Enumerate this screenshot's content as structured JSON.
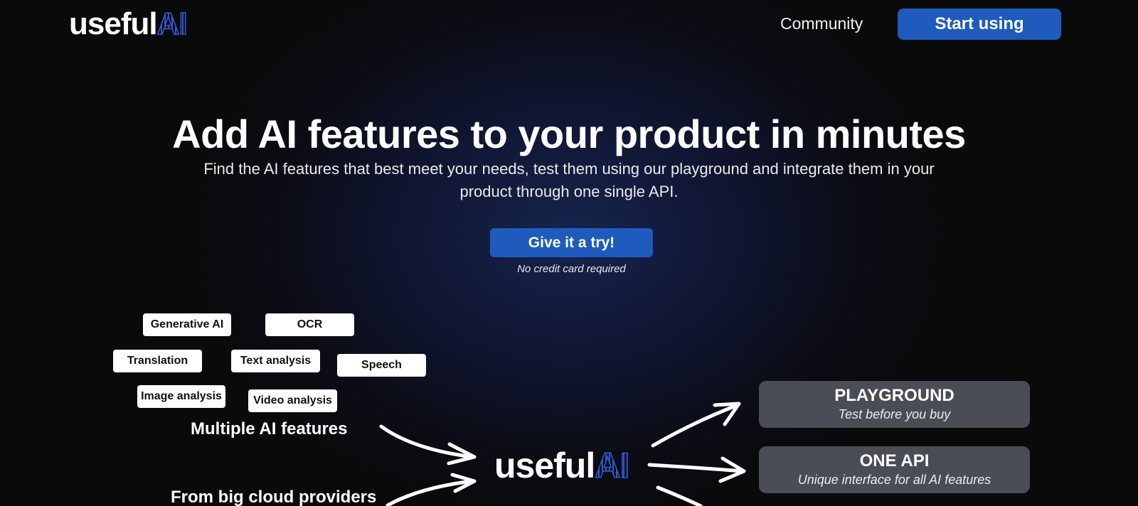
{
  "header": {
    "logo_text": "useful",
    "logo_accent": "AI",
    "nav_community": "Community",
    "cta_label": "Start using"
  },
  "hero": {
    "title": "Add AI features to your product in minutes",
    "subtitle": "Find the AI features that best meet your needs, test them using our playground and integrate them in your product through one single API.",
    "cta_label": "Give it a try!",
    "note": "No credit card required"
  },
  "diagram": {
    "chips": [
      "Generative AI",
      "OCR",
      "Translation",
      "Text analysis",
      "Speech",
      "Image analysis",
      "Video analysis"
    ],
    "caption_features": "Multiple AI features",
    "caption_providers": "From big cloud providers",
    "center_logo_text": "useful",
    "center_logo_accent": "AI",
    "cards": [
      {
        "title": "PLAYGROUND",
        "subtitle": "Test before you buy"
      },
      {
        "title": "ONE API",
        "subtitle": "Unique interface for all AI features"
      }
    ]
  },
  "colors": {
    "brand_blue": "#1e5bbd",
    "logo_accent": "#2d5bd6",
    "card_bg": "#4a4c56"
  }
}
